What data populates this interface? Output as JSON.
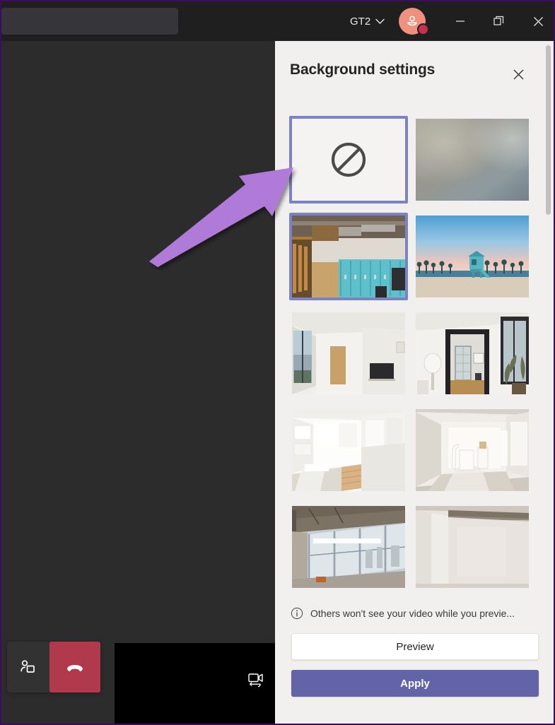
{
  "window": {
    "accent_border": "#3c0d5e",
    "titlebar_bg": "#1f1f1f",
    "search": {
      "value": "",
      "placeholder": ""
    },
    "org_switcher": {
      "label": "GT2",
      "icon": "chevron-down-icon"
    },
    "avatar": {
      "icon": "person-avatar-icon",
      "color": "#f0907f",
      "status": "busy",
      "status_color": "#c4314b"
    },
    "controls": {
      "minimize": "minimize-icon",
      "restore": "restore-icon",
      "close": "close-icon"
    }
  },
  "stage": {
    "bg": "#2d2c2c",
    "people_button": {
      "icon": "people-icon",
      "label": "Show participants"
    },
    "hangup_button": {
      "icon": "hangup-phone-icon",
      "label": "Hang up",
      "color": "#b03a4c"
    },
    "self_view": {
      "switch_camera_icon": "switch-camera-icon"
    }
  },
  "panel": {
    "title": "Background settings",
    "close_icon": "close-icon",
    "accent": "#6264a7",
    "selection_border": "#7b83c4",
    "backgrounds": [
      {
        "name": "none",
        "type": "none",
        "icon": "no-background-icon",
        "selected": true,
        "hovered": false
      },
      {
        "name": "blur",
        "type": "blur",
        "selected": false,
        "hovered": false
      },
      {
        "name": "office-lockers",
        "type": "image",
        "selected": false,
        "hovered": true
      },
      {
        "name": "beach-lifeguard-tower",
        "type": "image",
        "selected": false,
        "hovered": false
      },
      {
        "name": "white-room-window",
        "type": "image",
        "selected": false,
        "hovered": false
      },
      {
        "name": "room-with-mirror",
        "type": "image",
        "selected": false,
        "hovered": false
      },
      {
        "name": "white-loft-stairs",
        "type": "image",
        "selected": false,
        "hovered": false
      },
      {
        "name": "bright-empty-room",
        "type": "image",
        "selected": false,
        "hovered": false
      },
      {
        "name": "industrial-windows",
        "type": "image",
        "selected": false,
        "hovered": false
      },
      {
        "name": "plain-concrete-wall",
        "type": "image",
        "selected": false,
        "hovered": false
      }
    ],
    "notice": {
      "icon": "info-icon",
      "text": "Others won't see your video while you previe..."
    },
    "preview_button": "Preview",
    "apply_button": "Apply",
    "scrollbar": {
      "color": "#c1c0bf"
    }
  },
  "annotation": {
    "type": "arrow",
    "color": "#b07ad9",
    "points_to": "none-background-thumbnail"
  }
}
